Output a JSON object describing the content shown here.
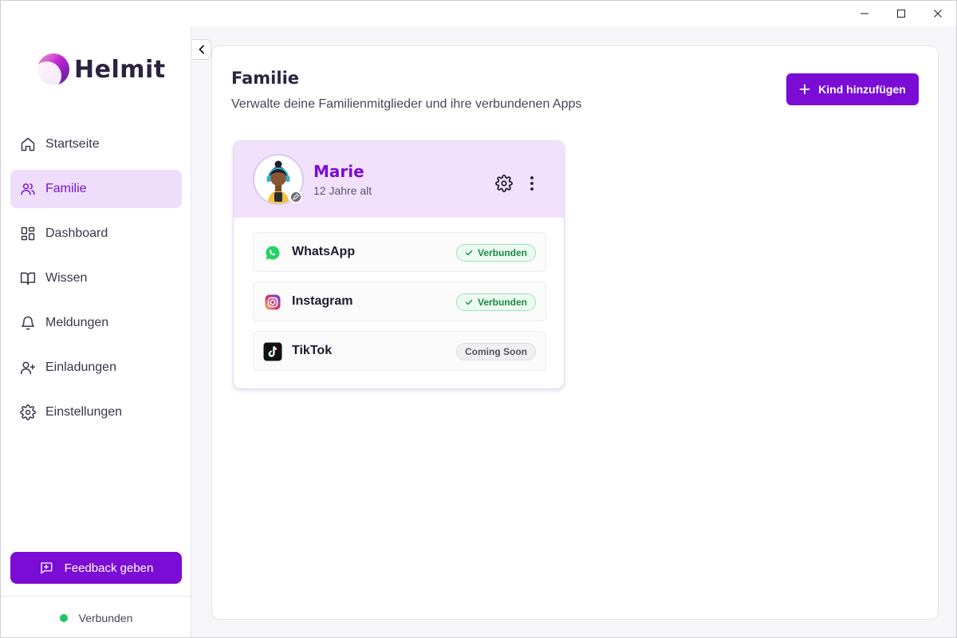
{
  "window": {
    "controls": [
      "minimize",
      "maximize",
      "close"
    ]
  },
  "sidebar": {
    "brand": "Helmit",
    "items": [
      {
        "label": "Startseite",
        "icon": "home-icon",
        "active": false
      },
      {
        "label": "Familie",
        "icon": "users-icon",
        "active": true
      },
      {
        "label": "Dashboard",
        "icon": "dashboard-icon",
        "active": false
      },
      {
        "label": "Wissen",
        "icon": "book-icon",
        "active": false
      },
      {
        "label": "Meldungen",
        "icon": "bell-icon",
        "active": false
      },
      {
        "label": "Einladungen",
        "icon": "user-plus-icon",
        "active": false
      },
      {
        "label": "Einstellungen",
        "icon": "gear-icon",
        "active": false
      }
    ],
    "feedback_label": "Feedback geben",
    "status_label": "Verbunden",
    "status_color": "#22c55e"
  },
  "main": {
    "title": "Familie",
    "subtitle": "Verwalte deine Familienmitglieder und ihre verbundenen Apps",
    "add_child_label": "Kind hinzufügen",
    "children": [
      {
        "name": "Marie",
        "age": "12 Jahre alt",
        "apps": [
          {
            "name": "WhatsApp",
            "icon": "whatsapp-icon",
            "status": "Verbunden",
            "state": "connected"
          },
          {
            "name": "Instagram",
            "icon": "instagram-icon",
            "status": "Verbunden",
            "state": "connected"
          },
          {
            "name": "TikTok",
            "icon": "tiktok-icon",
            "status": "Coming Soon",
            "state": "soon"
          }
        ]
      }
    ]
  },
  "colors": {
    "accent": "#7a0cd6",
    "active_nav_bg": "#eedefc",
    "card_header_bg": "#f1e1fd",
    "connected_badge": "#1a8a44"
  }
}
